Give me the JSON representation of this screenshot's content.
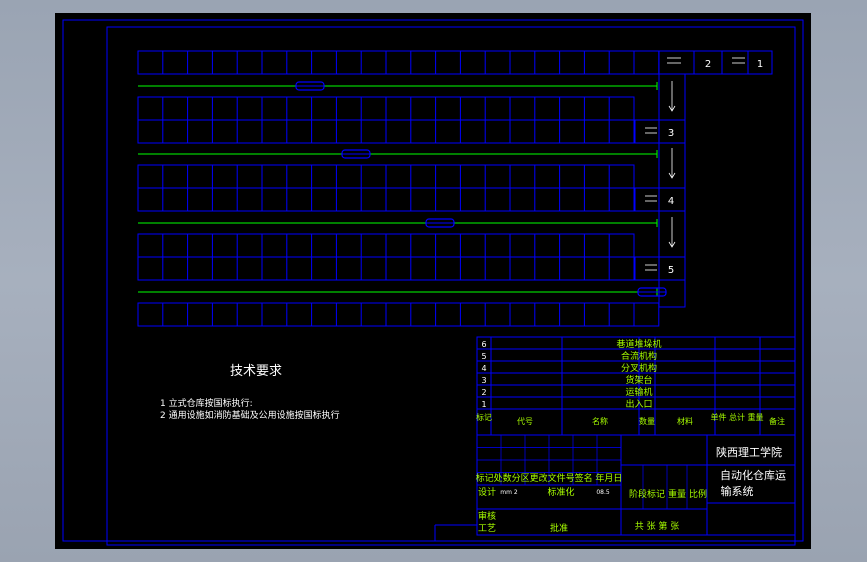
{
  "drawing": {
    "tech_title": "技术要求",
    "tech_items": [
      "1  立式仓库按国标执行:",
      "2  通用设施如消防基础及公用设施按国标执行"
    ],
    "station_labels": [
      "1",
      "2",
      "3",
      "4",
      "5"
    ],
    "school": "陕西理工学院",
    "project_line1": "自动化仓库运",
    "project_line2": "输系统",
    "bom_rows": [
      {
        "no": "6",
        "name": "巷道堆垛机"
      },
      {
        "no": "5",
        "name": "合流机构"
      },
      {
        "no": "4",
        "name": "分叉机构"
      },
      {
        "no": "3",
        "name": "货架台"
      },
      {
        "no": "2",
        "name": "运输机"
      },
      {
        "no": "1",
        "name": "出入口"
      }
    ],
    "bom_header": {
      "mark": "标记",
      "code": "代号",
      "name": "名称",
      "qty": "数量",
      "material": "材料",
      "weight": "单件 总计 重量",
      "remark": "备注"
    },
    "title_block": {
      "revision_header": "标记处数分区更改文件号签名 年月日",
      "design": "设计",
      "design_sig": "mm 2",
      "standardize": "标准化",
      "date": "08.5",
      "stage_mark": "阶段标记",
      "weight": "重量",
      "scale": "比例",
      "review": "审核",
      "process": "工艺",
      "approve": "批准",
      "sheets": "共  张  第  张"
    }
  },
  "colors": {
    "background": "#000000",
    "border": "#0000ff",
    "rack": "#0000ff",
    "track": "#00ff00",
    "text_green": "#a8ff00",
    "text_white": "#ffffff"
  }
}
